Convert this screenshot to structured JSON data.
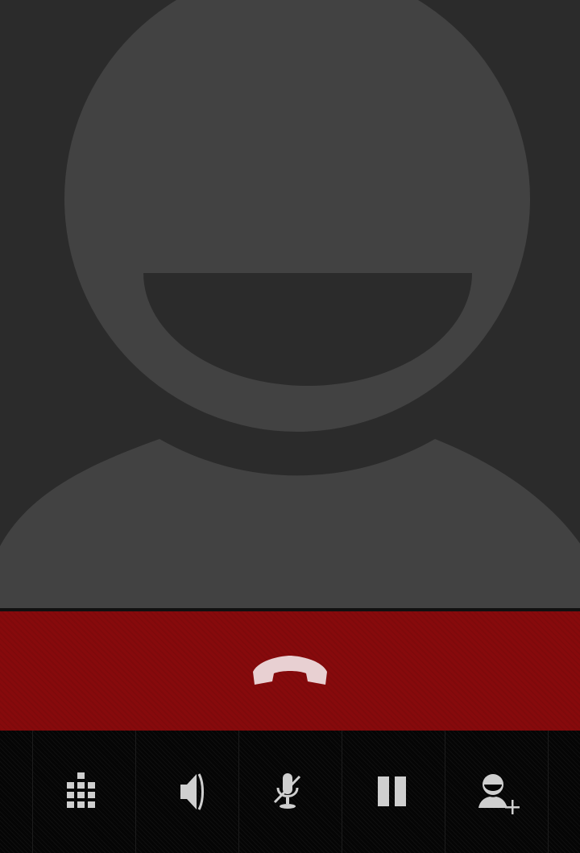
{
  "call_screen": {
    "contact_photo": {
      "icon": "default-contact-avatar-icon"
    },
    "end_call_button": {
      "icon": "phone-hangup-icon",
      "color": "#870a0c"
    },
    "controls": [
      {
        "id": "dialpad",
        "icon": "dialpad-icon"
      },
      {
        "id": "speaker",
        "icon": "speaker-icon"
      },
      {
        "id": "mute",
        "icon": "mic-mute-icon"
      },
      {
        "id": "hold",
        "icon": "pause-icon"
      },
      {
        "id": "add-call",
        "icon": "add-person-icon"
      }
    ]
  },
  "colors": {
    "background": "#2b2b2b",
    "avatar": "#424242",
    "end_call_red": "#870a0c",
    "icon": "#cfcfcf"
  }
}
